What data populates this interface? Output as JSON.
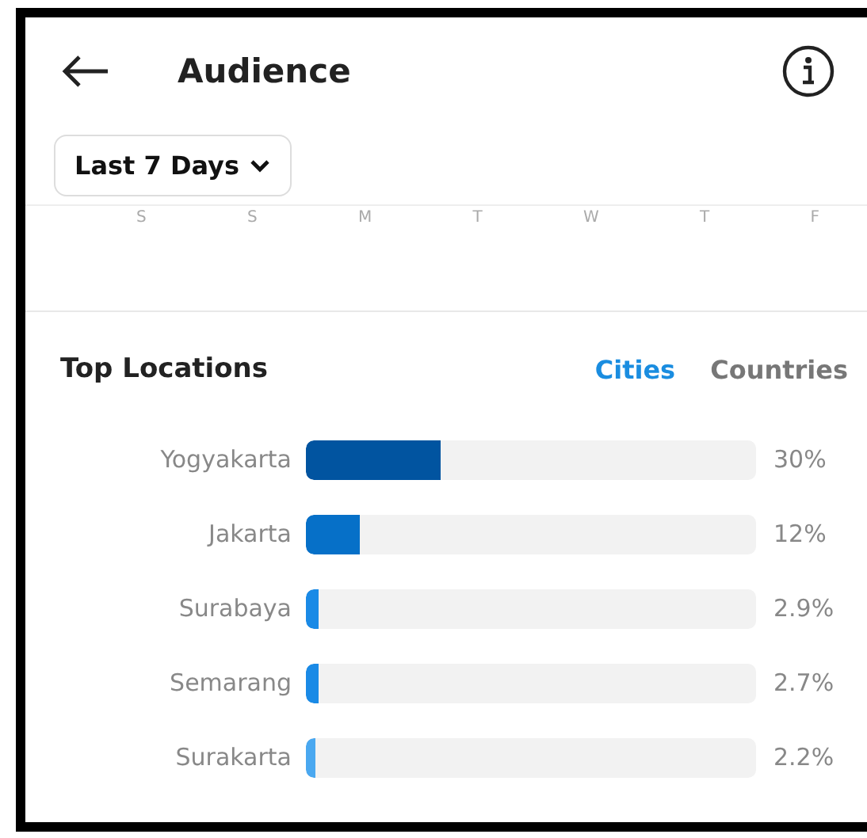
{
  "header": {
    "title": "Audience"
  },
  "range_button": {
    "label": "Last 7 Days"
  },
  "day_labels": [
    "S",
    "S",
    "M",
    "T",
    "W",
    "T",
    "F"
  ],
  "top_locations": {
    "title": "Top Locations",
    "tabs": [
      {
        "label": "Cities",
        "selected": true
      },
      {
        "label": "Countries",
        "selected": false
      }
    ],
    "items": [
      {
        "name": "Yogyakarta",
        "level": 0.3,
        "reading": "30%",
        "color": "#0154a0"
      },
      {
        "name": "Jakarta",
        "level": 0.12,
        "reading": "12%",
        "color": "#0670c8"
      },
      {
        "name": "Surabaya",
        "level": 0.029,
        "reading": "2.9%",
        "color": "#1a8ae6"
      },
      {
        "name": "Semarang",
        "level": 0.027,
        "reading": "2.7%",
        "color": "#1a8ae6"
      },
      {
        "name": "Surakarta",
        "level": 0.022,
        "reading": "2.2%",
        "color": "#4aa8f0"
      }
    ]
  }
}
